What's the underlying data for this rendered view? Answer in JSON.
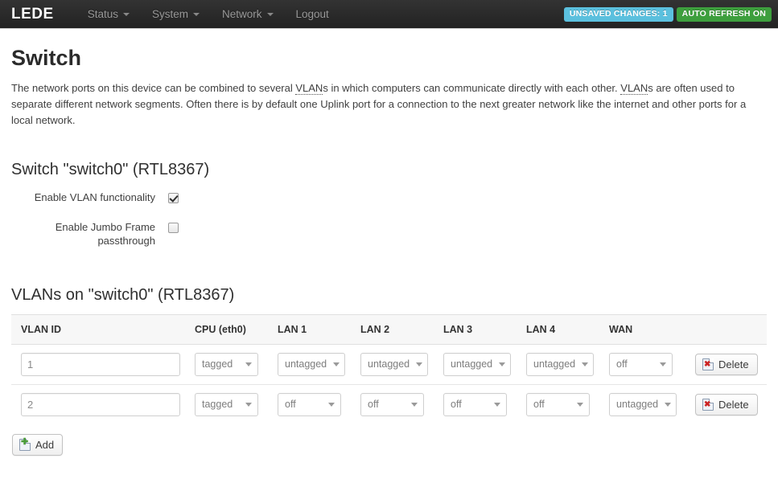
{
  "navbar": {
    "brand": "LEDE",
    "menu": [
      {
        "label": "Status",
        "has_caret": true
      },
      {
        "label": "System",
        "has_caret": true
      },
      {
        "label": "Network",
        "has_caret": true
      },
      {
        "label": "Logout",
        "has_caret": false
      }
    ],
    "badges": {
      "unsaved": "UNSAVED CHANGES: 1",
      "unsaved_color": "#5bc0de",
      "auto_refresh": "AUTO REFRESH ON",
      "auto_refresh_color": "#3d9f3d"
    }
  },
  "page": {
    "title": "Switch",
    "intro_1": "The network ports on this device can be combined to several ",
    "abbr_1": "VLAN",
    "intro_2": "s in which computers can communicate directly with each other. ",
    "abbr_2": "VLAN",
    "intro_3": "s are often used to separate different network segments. Often there is by default one Uplink port for a connection to the next greater network like the internet and other ports for a local network."
  },
  "switch_section": {
    "legend": "Switch \"switch0\" (RTL8367)",
    "options": [
      {
        "label": "Enable VLAN functionality",
        "checked": true
      },
      {
        "label": "Enable Jumbo Frame passthrough",
        "checked": false
      }
    ]
  },
  "vlan_section": {
    "legend": "VLANs on \"switch0\" (RTL8367)",
    "columns": [
      "VLAN ID",
      "CPU (eth0)",
      "LAN 1",
      "LAN 2",
      "LAN 3",
      "LAN 4",
      "WAN",
      ""
    ],
    "rows": [
      {
        "vlan_id": "1",
        "cpu": "tagged",
        "lan1": "untagged",
        "lan2": "untagged",
        "lan3": "untagged",
        "lan4": "untagged",
        "wan": "off",
        "delete_label": "Delete"
      },
      {
        "vlan_id": "2",
        "cpu": "tagged",
        "lan1": "off",
        "lan2": "off",
        "lan3": "off",
        "lan4": "off",
        "wan": "untagged",
        "delete_label": "Delete"
      }
    ],
    "port_options": [
      "off",
      "untagged",
      "tagged"
    ],
    "add_label": "Add"
  }
}
